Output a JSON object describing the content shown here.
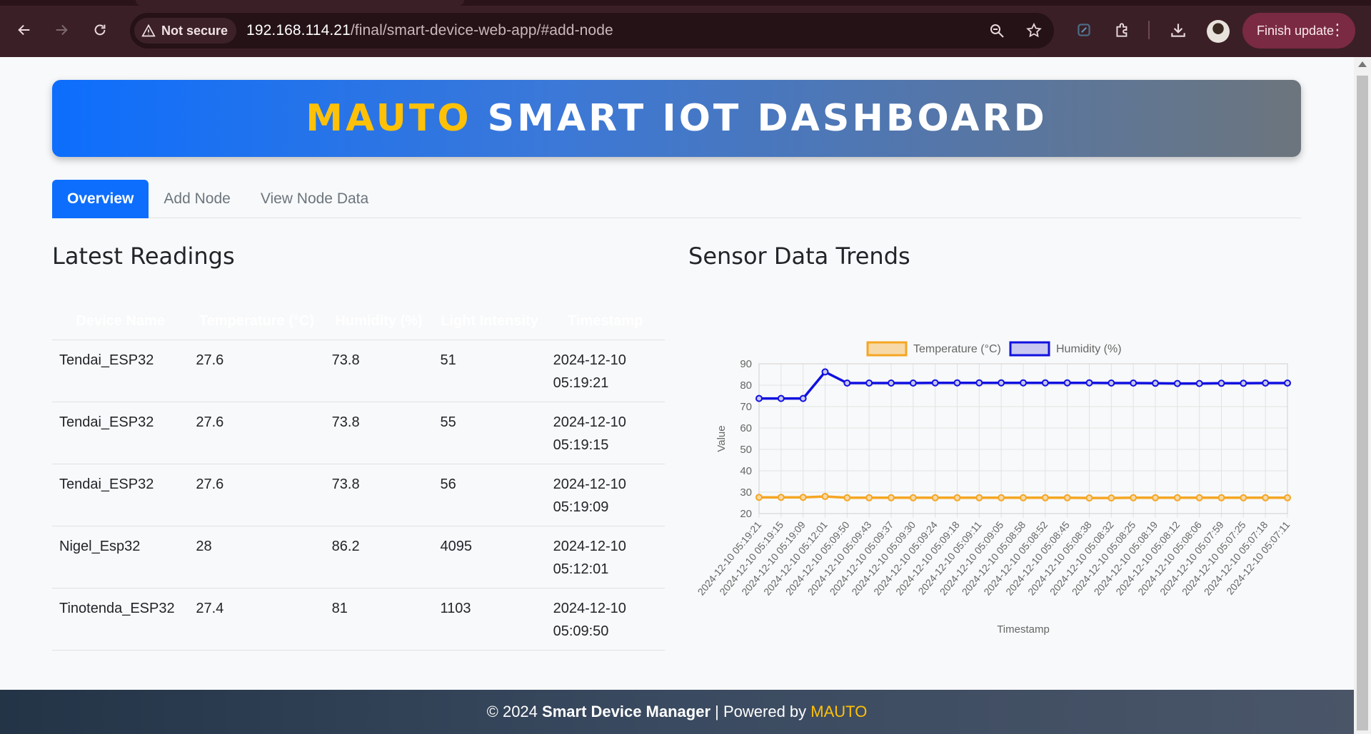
{
  "browser": {
    "security_label": "Not secure",
    "url_host": "192.168.114.21",
    "url_path": "/final/smart-device-web-app/#add-node",
    "update_label": "Finish update"
  },
  "header": {
    "brand": "MAUTO",
    "title": "SMART IOT DASHBOARD"
  },
  "tabs": [
    {
      "label": "Overview",
      "active": true
    },
    {
      "label": "Add Node",
      "active": false
    },
    {
      "label": "View Node Data",
      "active": false
    }
  ],
  "readings": {
    "title": "Latest Readings",
    "columns": [
      "Device Name",
      "Temperature (°C)",
      "Humidity (%)",
      "Light Intensity",
      "Timestamp"
    ],
    "rows": [
      {
        "device": "Tendai_ESP32",
        "temperature": "27.6",
        "humidity": "73.8",
        "light": "51",
        "date": "2024-12-10",
        "time": "05:19:21"
      },
      {
        "device": "Tendai_ESP32",
        "temperature": "27.6",
        "humidity": "73.8",
        "light": "55",
        "date": "2024-12-10",
        "time": "05:19:15"
      },
      {
        "device": "Tendai_ESP32",
        "temperature": "27.6",
        "humidity": "73.8",
        "light": "56",
        "date": "2024-12-10",
        "time": "05:19:09"
      },
      {
        "device": "Nigel_Esp32",
        "temperature": "28",
        "humidity": "86.2",
        "light": "4095",
        "date": "2024-12-10",
        "time": "05:12:01"
      },
      {
        "device": "Tinotenda_ESP32",
        "temperature": "27.4",
        "humidity": "81",
        "light": "1103",
        "date": "2024-12-10",
        "time": "05:09:50"
      }
    ]
  },
  "trends": {
    "title": "Sensor Data Trends"
  },
  "chart_data": {
    "type": "line",
    "title": "",
    "xlabel": "Timestamp",
    "ylabel": "Value",
    "ylim": [
      20,
      90
    ],
    "yticks": [
      20,
      30,
      40,
      50,
      60,
      70,
      80,
      90
    ],
    "grid": true,
    "legend": "top",
    "x": [
      "2024-12-10 05:19:21",
      "2024-12-10 05:19:15",
      "2024-12-10 05:19:09",
      "2024-12-10 05:12:01",
      "2024-12-10 05:09:50",
      "2024-12-10 05:09:43",
      "2024-12-10 05:09:37",
      "2024-12-10 05:09:30",
      "2024-12-10 05:09:24",
      "2024-12-10 05:09:18",
      "2024-12-10 05:09:11",
      "2024-12-10 05:09:05",
      "2024-12-10 05:08:58",
      "2024-12-10 05:08:52",
      "2024-12-10 05:08:45",
      "2024-12-10 05:08:38",
      "2024-12-10 05:08:32",
      "2024-12-10 05:08:25",
      "2024-12-10 05:08:19",
      "2024-12-10 05:08:12",
      "2024-12-10 05:08:06",
      "2024-12-10 05:07:59",
      "2024-12-10 05:07:25",
      "2024-12-10 05:07:18",
      "2024-12-10 05:07:11"
    ],
    "series": [
      {
        "name": "Temperature (°C)",
        "color": "#f5a623",
        "fill": "#f7d9a8",
        "values": [
          27.6,
          27.6,
          27.6,
          28,
          27.4,
          27.4,
          27.4,
          27.4,
          27.4,
          27.4,
          27.4,
          27.4,
          27.4,
          27.4,
          27.4,
          27.3,
          27.3,
          27.4,
          27.4,
          27.4,
          27.4,
          27.4,
          27.4,
          27.4,
          27.4
        ]
      },
      {
        "name": "Humidity (%)",
        "color": "#1010e0",
        "fill": "#c8c8f0",
        "values": [
          73.8,
          73.8,
          73.8,
          86.2,
          81,
          81,
          81,
          81,
          81.1,
          81.1,
          81.1,
          81.1,
          81.1,
          81.1,
          81.1,
          81.1,
          81,
          81,
          80.9,
          80.8,
          80.8,
          80.9,
          80.9,
          81,
          81
        ]
      }
    ]
  },
  "footer": {
    "copyright": "© 2024",
    "app_name": "Smart Device Manager",
    "separator": "| Powered by",
    "brand": "MAUTO"
  }
}
